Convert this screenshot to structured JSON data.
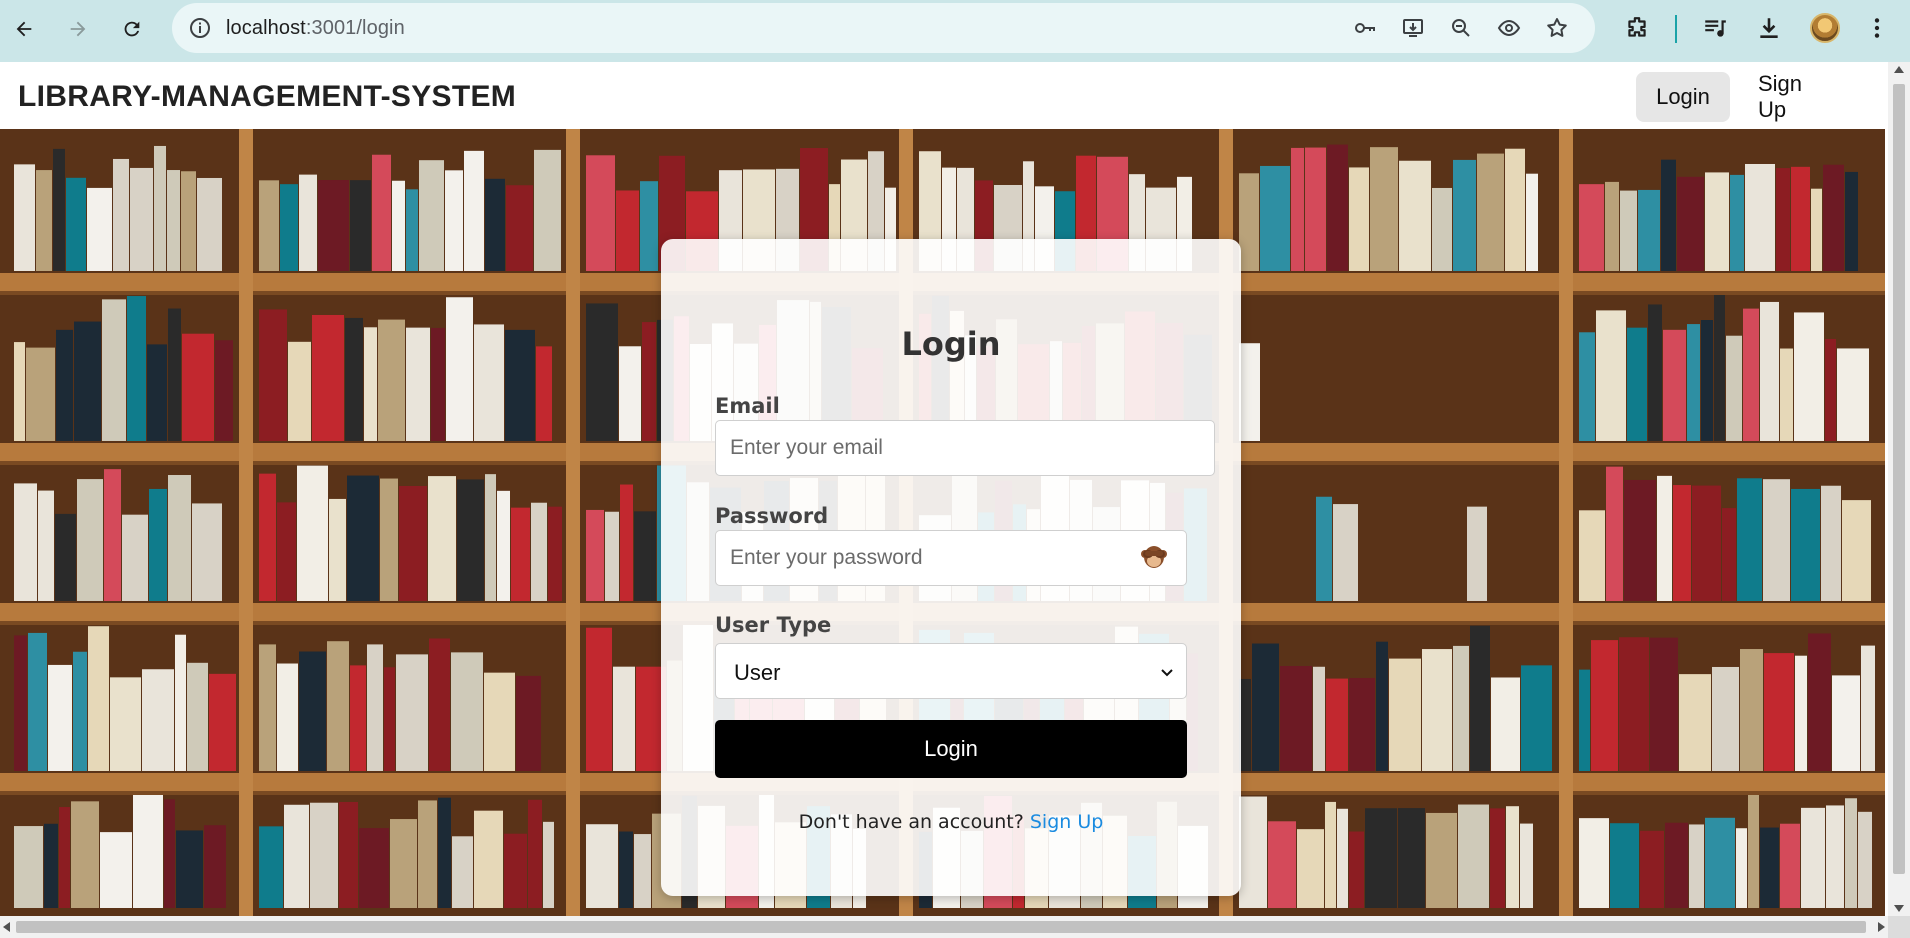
{
  "browser": {
    "url_host": "localhost",
    "url_path": ":3001/login",
    "icons": [
      "back-icon",
      "forward-icon",
      "reload-icon",
      "site-info-icon",
      "password-key-icon",
      "install-app-icon",
      "zoom-out-icon",
      "eye-icon",
      "bookmark-star-icon",
      "extensions-icon",
      "media-playlist-icon",
      "download-icon",
      "profile-avatar",
      "menu-kebab-icon"
    ]
  },
  "header": {
    "title": "LIBRARY-MANAGEMENT-SYSTEM",
    "nav": {
      "login": "Login",
      "signup": "Sign Up"
    }
  },
  "login_form": {
    "title": "Login",
    "email_label": "Email",
    "email_placeholder": "Enter your email",
    "password_label": "Password",
    "password_placeholder": "Enter your password",
    "password_toggle_icon": "see-no-evil-monkey-icon",
    "user_type_label": "User Type",
    "user_type_selected": "User",
    "submit_label": "Login",
    "signup_prompt": "Don't have an account?",
    "signup_link": "Sign Up"
  },
  "colors": {
    "browser_bar": "#cbe6e8",
    "url_bar": "#eaf6f7",
    "button": "#000000",
    "link": "#1a8be0",
    "shelf_wood": "#b77a3d"
  }
}
